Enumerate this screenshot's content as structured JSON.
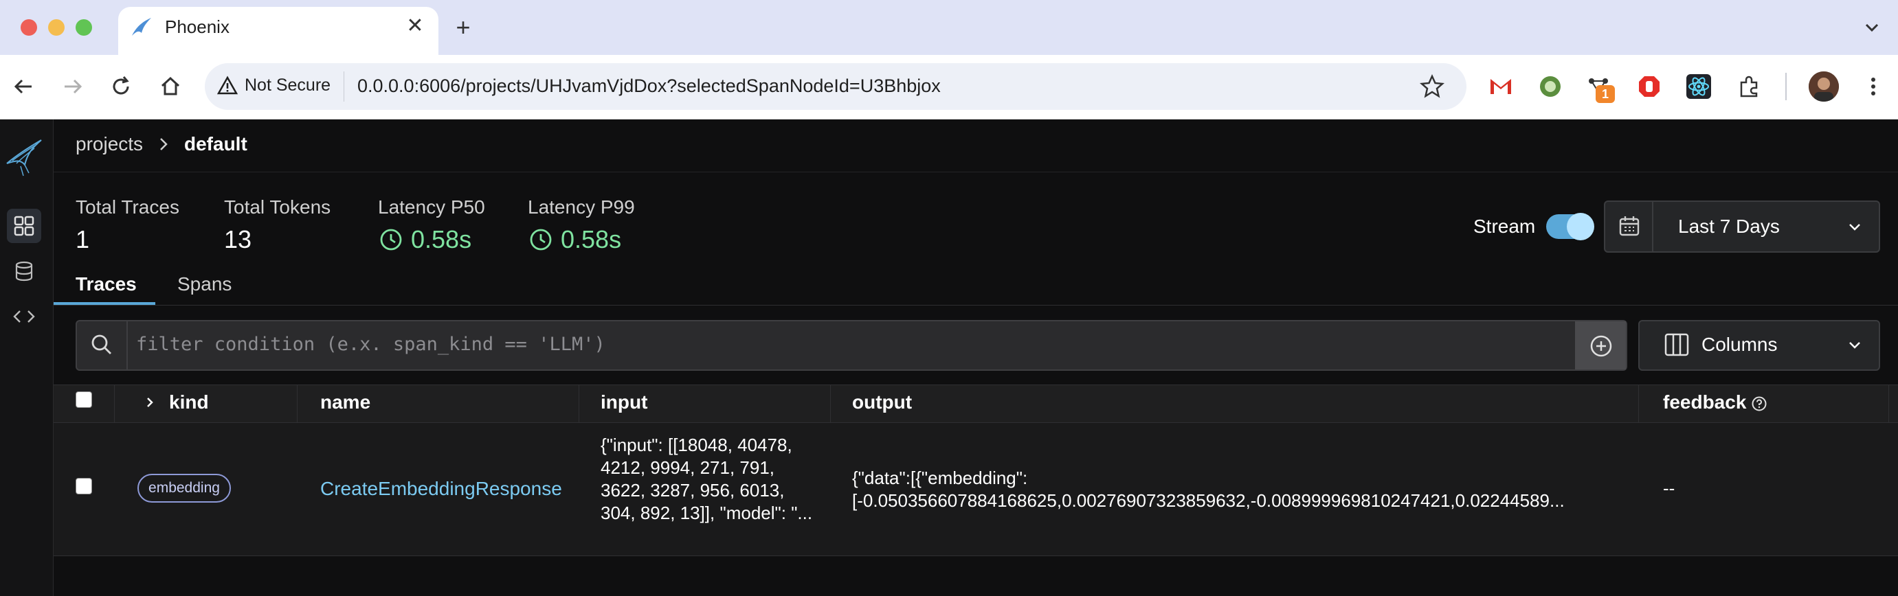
{
  "browser": {
    "tab_title": "Phoenix",
    "not_secure_label": "Not Secure",
    "url": "0.0.0.0:6006/projects/UHJvamVjdDox?selectedSpanNodeId=U3Bhbjox",
    "extension_badge": "1"
  },
  "breadcrumb": {
    "projects": "projects",
    "current": "default"
  },
  "stats": {
    "total_traces_label": "Total Traces",
    "total_traces_value": "1",
    "total_tokens_label": "Total Tokens",
    "total_tokens_value": "13",
    "latency_p50_label": "Latency P50",
    "latency_p50_value": "0.58s",
    "latency_p99_label": "Latency P99",
    "latency_p99_value": "0.58s"
  },
  "controls": {
    "stream_label": "Stream",
    "stream_on": true,
    "time_range": "Last 7 Days",
    "columns_label": "Columns",
    "filter_placeholder": "filter condition (e.x. span_kind == 'LLM')"
  },
  "tabs": {
    "traces": "Traces",
    "spans": "Spans"
  },
  "table": {
    "headers": {
      "kind": "kind",
      "name": "name",
      "input": "input",
      "output": "output",
      "feedback": "feedback"
    },
    "rows": [
      {
        "kind": "embedding",
        "name": "CreateEmbeddingResponse",
        "input": "{\"input\": [[18048, 40478, 4212, 9994, 271, 791, 3622, 3287, 956, 6013, 304, 892, 13]], \"model\": \"...",
        "output": "{\"data\":[{\"embedding\": [-0.050356607884168625,0.00276907323859632,-0.008999969810247421,0.02244589...",
        "feedback": "--"
      }
    ]
  },
  "colors": {
    "accent": "#5aa8d8",
    "latency_green": "#7fe3a0",
    "link": "#7ccbf2",
    "background": "#0f0f10"
  }
}
